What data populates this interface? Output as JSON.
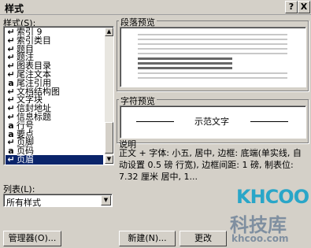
{
  "window": {
    "title": "样式",
    "help_btn": "?",
    "close_btn": "X"
  },
  "styles": {
    "label": "样式(S):",
    "items": [
      {
        "sym": "↵",
        "text": "索引 9"
      },
      {
        "sym": "↵",
        "text": "索引类目"
      },
      {
        "sym": "↵",
        "text": "题目"
      },
      {
        "sym": "↵",
        "text": "题注"
      },
      {
        "sym": "↵",
        "text": "图表目录"
      },
      {
        "sym": "↵",
        "text": "尾注文本"
      },
      {
        "sym": "a",
        "text": "尾注引用"
      },
      {
        "sym": "↵",
        "text": "文档结构图"
      },
      {
        "sym": "↵",
        "text": "文字块"
      },
      {
        "sym": "↵",
        "text": "信封地址"
      },
      {
        "sym": "↵",
        "text": "信息标题"
      },
      {
        "sym": "a",
        "text": "行号"
      },
      {
        "sym": "a",
        "text": "要点"
      },
      {
        "sym": "↵",
        "text": "页脚"
      },
      {
        "sym": "a",
        "text": "页码"
      },
      {
        "sym": "↵",
        "text": "页眉"
      }
    ],
    "selected_index": 15
  },
  "paragraph_preview": {
    "label": "段落预览"
  },
  "char_preview": {
    "label": "字符预览",
    "sample": "示范文字"
  },
  "description": {
    "label": "说明",
    "text": "正文 + 字体: 小五, 居中, 边框: 底端(单实线, 自动设置 0.5 磅 行宽), 边框间距: 1 磅, 制表位: 7.32 厘米 居中, 1..."
  },
  "list_filter": {
    "label": "列表(L):",
    "value": "所有样式"
  },
  "buttons": {
    "organizer": "管理器(O)...",
    "new": "新建(N)...",
    "modify": "更改"
  },
  "watermark": {
    "logo": "KHCOO",
    "name": "科技库",
    "url": "khcoo.com"
  }
}
